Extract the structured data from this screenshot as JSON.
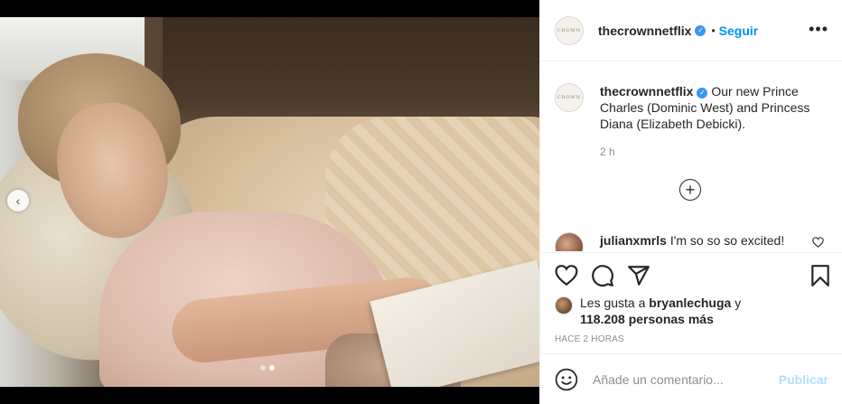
{
  "post": {
    "username": "thecrownnetflix",
    "avatar_text": "CROWN",
    "separator": "•",
    "follow_label": "Seguir",
    "more_icon": "more-options-icon",
    "more_glyph": "•••"
  },
  "carousel": {
    "prev_glyph": "‹",
    "slide_count": 2,
    "active_slide": 2
  },
  "caption": {
    "username": "thecrownnetflix",
    "text": "Our new Prince Charles (Dominic West) and Princess Diana (Elizabeth Debicki).",
    "time": "2 h"
  },
  "load_more_glyph": "+",
  "comments": [
    {
      "username": "julianxmrls",
      "text": "I'm so so so excited!"
    }
  ],
  "likes": {
    "prefix": "Les gusta a",
    "user": "bryanlechuga",
    "connector": "y",
    "count": "118.208 personas más"
  },
  "timestamp": "HACE 2 HORAS",
  "comment_box": {
    "placeholder": "Añade un comentario...",
    "publish_label": "Publicar"
  },
  "colors": {
    "accent": "#0095f6",
    "verified": "#3897f0",
    "publish_disabled": "#b2dffc",
    "text": "#262626",
    "muted": "#8e8e8e"
  }
}
